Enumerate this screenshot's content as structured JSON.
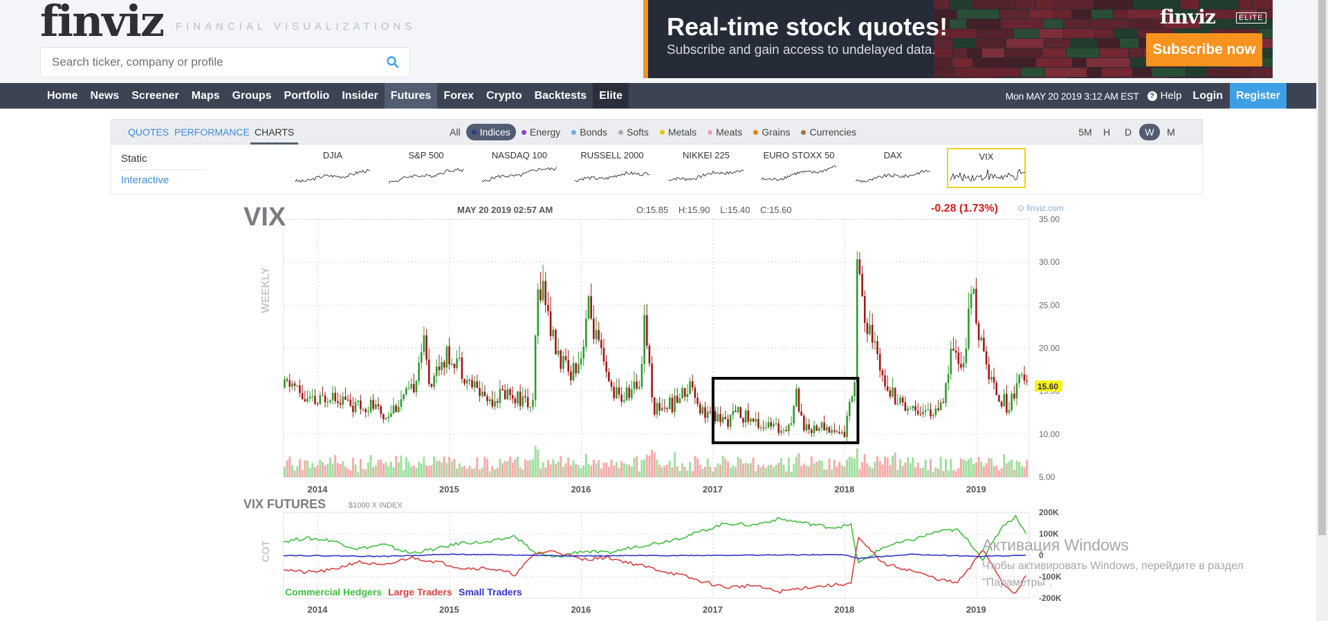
{
  "header": {
    "logo": "finviz",
    "tagline": "FINANCIAL VISUALIZATIONS",
    "search_placeholder": "Search ticker, company or profile"
  },
  "banner": {
    "headline": "Real-time stock quotes!",
    "subtext": "Subscribe and gain access to undelayed data.",
    "logo": "finviz",
    "badge": "ELITE",
    "cta": "Subscribe now"
  },
  "nav": {
    "items": [
      "Home",
      "News",
      "Screener",
      "Maps",
      "Groups",
      "Portfolio",
      "Insider",
      "Futures",
      "Forex",
      "Crypto",
      "Backtests",
      "Elite"
    ],
    "active": "Futures",
    "datetime": "Mon MAY 20 2019 3:12 AM EST",
    "help": "Help",
    "login": "Login",
    "register": "Register"
  },
  "tabs": {
    "views": [
      "QUOTES",
      "PERFORMANCE",
      "CHARTS"
    ],
    "active_view": "CHARTS",
    "groups": [
      {
        "label": "All",
        "color": ""
      },
      {
        "label": "Indices",
        "color": "#2b3a8f"
      },
      {
        "label": "Energy",
        "color": "#8a3fd1"
      },
      {
        "label": "Bonds",
        "color": "#6cb2f0"
      },
      {
        "label": "Softs",
        "color": "#a7abb3"
      },
      {
        "label": "Metals",
        "color": "#f2c200"
      },
      {
        "label": "Meats",
        "color": "#f09ad2"
      },
      {
        "label": "Grains",
        "color": "#f07f13"
      },
      {
        "label": "Currencies",
        "color": "#a5743d"
      }
    ],
    "active_group": "Indices",
    "timeframes": [
      "5M",
      "H",
      "D",
      "W",
      "M"
    ],
    "active_timeframe": "W"
  },
  "chart_modes": {
    "static": "Static",
    "interactive": "Interactive"
  },
  "mini_charts": [
    "DJIA",
    "S&P 500",
    "NASDAQ 100",
    "RUSSELL 2000",
    "NIKKEI 225",
    "EURO STOXX 50",
    "DAX",
    "VIX"
  ],
  "selected_mini": "VIX",
  "chart": {
    "ticker": "VIX",
    "date": "MAY 20 2019 02:57 AM",
    "open": "O:15.85",
    "high": "H:15.90",
    "low": "L:15.40",
    "close": "C:15.60",
    "change": "-0.28 (1.73%)",
    "brand": "finviz.com",
    "period_label": "WEEKLY",
    "last_price": "15.60",
    "cot_title": "VIX FUTURES",
    "cot_subtitle": "$1000 X INDEX",
    "cot_label": "COT",
    "legend": [
      "Commercial Hedgers",
      "Large Traders",
      "Small Traders"
    ]
  },
  "chart_data": [
    {
      "type": "candlestick",
      "title": "VIX",
      "subtitle": "WEEKLY",
      "x_ticks": [
        "2014",
        "2015",
        "2016",
        "2017",
        "2018",
        "2019"
      ],
      "y_ticks": [
        "35.00",
        "30.00",
        "25.00",
        "20.00",
        "15.00",
        "10.00",
        "5.00"
      ],
      "ylim": [
        5,
        35
      ],
      "last": 15.6,
      "price_path": [
        [
          2013.7,
          15
        ],
        [
          2013.8,
          16
        ],
        [
          2013.9,
          14
        ],
        [
          2014.0,
          13.5
        ],
        [
          2014.1,
          15
        ],
        [
          2014.2,
          14
        ],
        [
          2014.3,
          13
        ],
        [
          2014.4,
          13.5
        ],
        [
          2014.5,
          12
        ],
        [
          2014.6,
          13.5
        ],
        [
          2014.72,
          15
        ],
        [
          2014.8,
          21
        ],
        [
          2014.85,
          16
        ],
        [
          2014.95,
          19
        ],
        [
          2015.05,
          19
        ],
        [
          2015.15,
          16
        ],
        [
          2015.3,
          14
        ],
        [
          2015.45,
          15
        ],
        [
          2015.55,
          14
        ],
        [
          2015.64,
          13
        ],
        [
          2015.66,
          25
        ],
        [
          2015.7,
          28
        ],
        [
          2015.8,
          20
        ],
        [
          2015.9,
          17
        ],
        [
          2016.0,
          19
        ],
        [
          2016.05,
          25
        ],
        [
          2016.1,
          22
        ],
        [
          2016.2,
          16
        ],
        [
          2016.3,
          14
        ],
        [
          2016.45,
          16
        ],
        [
          2016.48,
          24
        ],
        [
          2016.55,
          13
        ],
        [
          2016.7,
          13.5
        ],
        [
          2016.85,
          16
        ],
        [
          2016.9,
          13
        ],
        [
          2017.0,
          12
        ],
        [
          2017.1,
          11.5
        ],
        [
          2017.2,
          12.5
        ],
        [
          2017.3,
          11.5
        ],
        [
          2017.4,
          11
        ],
        [
          2017.5,
          10.5
        ],
        [
          2017.6,
          11.5
        ],
        [
          2017.63,
          15
        ],
        [
          2017.7,
          10.5
        ],
        [
          2017.8,
          11
        ],
        [
          2017.9,
          10.5
        ],
        [
          2018.0,
          10
        ],
        [
          2018.08,
          17
        ],
        [
          2018.1,
          34
        ],
        [
          2018.15,
          23
        ],
        [
          2018.25,
          19
        ],
        [
          2018.35,
          15
        ],
        [
          2018.45,
          13.5
        ],
        [
          2018.55,
          13
        ],
        [
          2018.65,
          12.5
        ],
        [
          2018.75,
          13
        ],
        [
          2018.8,
          19
        ],
        [
          2018.9,
          18
        ],
        [
          2018.97,
          27
        ],
        [
          2019.05,
          19
        ],
        [
          2019.15,
          15
        ],
        [
          2019.25,
          13
        ],
        [
          2019.32,
          17
        ],
        [
          2019.38,
          15.6
        ]
      ],
      "annotation": {
        "label": "box",
        "x_range": [
          2017.0,
          2018.1
        ],
        "y_range": [
          9,
          16.5
        ]
      }
    },
    {
      "type": "line",
      "title": "VIX FUTURES",
      "subtitle": "$1000 X INDEX",
      "x_ticks": [
        "2014",
        "2015",
        "2016",
        "2017",
        "2018",
        "2019"
      ],
      "y_ticks": [
        "200K",
        "100K",
        "0",
        "-100K",
        "-200K"
      ],
      "ylim": [
        -200,
        200
      ],
      "y_unit": "K",
      "series": [
        {
          "name": "Commercial Hedgers",
          "color": "#3fbf3f",
          "values": [
            [
              2013.7,
              60
            ],
            [
              2013.9,
              80
            ],
            [
              2014.1,
              70
            ],
            [
              2014.3,
              30
            ],
            [
              2014.5,
              50
            ],
            [
              2014.7,
              10
            ],
            [
              2014.9,
              30
            ],
            [
              2015.1,
              60
            ],
            [
              2015.3,
              60
            ],
            [
              2015.5,
              90
            ],
            [
              2015.65,
              10
            ],
            [
              2015.8,
              -10
            ],
            [
              2016.0,
              20
            ],
            [
              2016.2,
              10
            ],
            [
              2016.4,
              40
            ],
            [
              2016.6,
              60
            ],
            [
              2016.8,
              90
            ],
            [
              2016.9,
              110
            ],
            [
              2017.1,
              150
            ],
            [
              2017.3,
              140
            ],
            [
              2017.5,
              170
            ],
            [
              2017.7,
              150
            ],
            [
              2017.9,
              130
            ],
            [
              2018.05,
              140
            ],
            [
              2018.1,
              -40
            ],
            [
              2018.3,
              40
            ],
            [
              2018.5,
              70
            ],
            [
              2018.7,
              110
            ],
            [
              2018.85,
              120
            ],
            [
              2018.95,
              60
            ],
            [
              2019.05,
              -20
            ],
            [
              2019.2,
              140
            ],
            [
              2019.3,
              180
            ],
            [
              2019.38,
              100
            ]
          ]
        },
        {
          "name": "Large Traders",
          "color": "#d94040",
          "values": [
            [
              2013.7,
              -60
            ],
            [
              2013.9,
              -80
            ],
            [
              2014.1,
              -70
            ],
            [
              2014.3,
              -30
            ],
            [
              2014.5,
              -50
            ],
            [
              2014.7,
              -10
            ],
            [
              2014.9,
              -30
            ],
            [
              2015.1,
              -60
            ],
            [
              2015.3,
              -60
            ],
            [
              2015.5,
              -90
            ],
            [
              2015.65,
              10
            ],
            [
              2015.8,
              20
            ],
            [
              2016.0,
              -20
            ],
            [
              2016.2,
              -10
            ],
            [
              2016.4,
              -40
            ],
            [
              2016.6,
              -70
            ],
            [
              2016.8,
              -100
            ],
            [
              2016.9,
              -120
            ],
            [
              2017.1,
              -150
            ],
            [
              2017.3,
              -140
            ],
            [
              2017.5,
              -170
            ],
            [
              2017.7,
              -150
            ],
            [
              2017.9,
              -140
            ],
            [
              2018.05,
              -130
            ],
            [
              2018.1,
              80
            ],
            [
              2018.3,
              -40
            ],
            [
              2018.5,
              -70
            ],
            [
              2018.7,
              -110
            ],
            [
              2018.85,
              -130
            ],
            [
              2018.95,
              -60
            ],
            [
              2019.05,
              30
            ],
            [
              2019.2,
              -130
            ],
            [
              2019.3,
              -180
            ],
            [
              2019.38,
              -90
            ]
          ]
        },
        {
          "name": "Small Traders",
          "color": "#3333cc",
          "values": [
            [
              2013.7,
              0
            ],
            [
              2014.5,
              -5
            ],
            [
              2015.0,
              5
            ],
            [
              2016.0,
              -3
            ],
            [
              2017.0,
              0
            ],
            [
              2018.0,
              3
            ],
            [
              2018.1,
              -15
            ],
            [
              2018.5,
              5
            ],
            [
              2019.0,
              -5
            ],
            [
              2019.38,
              0
            ]
          ]
        }
      ]
    }
  ],
  "watermark": {
    "title": "Активация Windows",
    "subtitle": "Чтобы активировать Windows, перейдите в раздел \"Параметры\"."
  }
}
